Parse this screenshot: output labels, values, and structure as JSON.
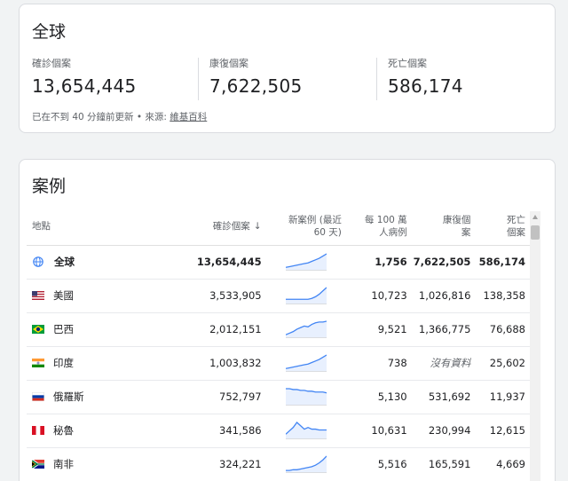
{
  "summary": {
    "title": "全球",
    "stats": [
      {
        "label": "確診個案",
        "value": "13,654,445"
      },
      {
        "label": "康復個案",
        "value": "7,622,505"
      },
      {
        "label": "死亡個案",
        "value": "586,174"
      }
    ],
    "updated_text": "已在不到 40 分鐘前更新 • 來源: ",
    "source_link": "維基百科"
  },
  "cases": {
    "title": "案例",
    "headers": {
      "place": "地點",
      "confirmed": "確診個案",
      "new_cases_line1": "新案例 (最近",
      "new_cases_line2": "60 天)",
      "per_million_line1": "每 100 萬",
      "per_million_line2": "人病例",
      "recovered_line1": "康復個",
      "recovered_line2": "案",
      "deaths_line1": "死亡",
      "deaths_line2": "個案"
    },
    "rows": [
      {
        "place": "全球",
        "flag": "globe-icon",
        "confirmed": "13,654,445",
        "per_million": "1,756",
        "recovered": "7,622,505",
        "deaths": "586,174",
        "trend": [
          2,
          3,
          4,
          5,
          6,
          7,
          8,
          10,
          12,
          14,
          17,
          20
        ]
      },
      {
        "place": "美國",
        "flag": "us-flag-icon",
        "confirmed": "3,533,905",
        "per_million": "10,723",
        "recovered": "1,026,816",
        "deaths": "138,358",
        "trend": [
          4,
          4,
          4,
          4,
          4,
          4,
          4,
          5,
          7,
          10,
          14,
          18
        ]
      },
      {
        "place": "巴西",
        "flag": "brazil-flag-icon",
        "confirmed": "2,012,151",
        "per_million": "9,521",
        "recovered": "1,366,775",
        "deaths": "76,688",
        "trend": [
          2,
          4,
          6,
          9,
          11,
          13,
          12,
          15,
          17,
          18,
          18,
          19
        ]
      },
      {
        "place": "印度",
        "flag": "india-flag-icon",
        "confirmed": "1,003,832",
        "per_million": "738",
        "recovered": "沒有資料",
        "deaths": "25,602",
        "trend": [
          2,
          3,
          4,
          5,
          6,
          7,
          8,
          10,
          12,
          14,
          17,
          20
        ]
      },
      {
        "place": "俄羅斯",
        "flag": "russia-flag-icon",
        "confirmed": "752,797",
        "per_million": "5,130",
        "recovered": "531,692",
        "deaths": "11,937",
        "trend": [
          18,
          18,
          17,
          17,
          16,
          16,
          15,
          15,
          14,
          14,
          14,
          13
        ]
      },
      {
        "place": "秘魯",
        "flag": "peru-flag-icon",
        "confirmed": "341,586",
        "per_million": "10,631",
        "recovered": "230,994",
        "deaths": "12,615",
        "trend": [
          4,
          8,
          12,
          18,
          14,
          10,
          12,
          10,
          10,
          9,
          9,
          9
        ]
      },
      {
        "place": "南非",
        "flag": "south-africa-flag-icon",
        "confirmed": "324,221",
        "per_million": "5,516",
        "recovered": "165,591",
        "deaths": "4,669",
        "trend": [
          1,
          1,
          2,
          2,
          3,
          4,
          5,
          6,
          8,
          11,
          15,
          20
        ]
      }
    ]
  },
  "colors": {
    "sparkline": "#4285f4",
    "sparkline_fill": "#e8f0fe",
    "globe": "#4285f4"
  }
}
